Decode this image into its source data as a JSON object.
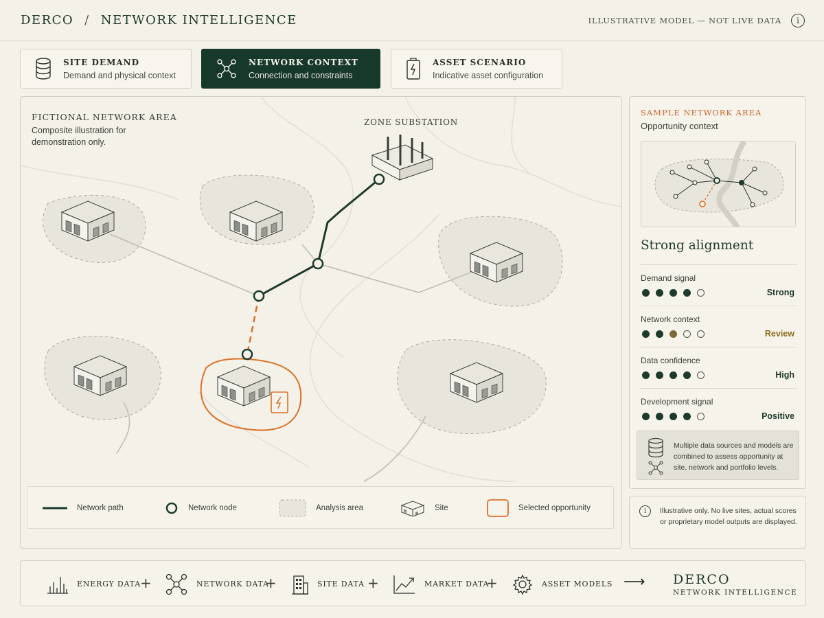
{
  "header": {
    "brand": "DERCO",
    "separator": "/",
    "section": "NETWORK INTELLIGENCE",
    "disclaimer": "ILLUSTRATIVE MODEL — NOT LIVE DATA",
    "info_icon": "info-icon"
  },
  "tabs": [
    {
      "title": "SITE DEMAND",
      "subtitle": "Demand and physical context",
      "icon": "database-icon",
      "active": false
    },
    {
      "title": "NETWORK CONTEXT",
      "subtitle": "Connection and constraints",
      "icon": "network-icon",
      "active": true
    },
    {
      "title": "ASSET SCENARIO",
      "subtitle": "Indicative asset configuration",
      "icon": "battery-icon",
      "active": false
    }
  ],
  "map": {
    "area_title": "FICTIONAL NETWORK AREA",
    "area_subtitle": "Composite illustration for demonstration only.",
    "substation_label": "ZONE SUBSTATION",
    "legend": {
      "network_path": "Network path",
      "network_node": "Network node",
      "analysis_area": "Analysis area",
      "site": "Site",
      "selected_opportunity": "Selected opportunity"
    }
  },
  "side": {
    "title": "SAMPLE NETWORK AREA",
    "subtitle": "Opportunity context",
    "alignment": "Strong alignment",
    "metrics": [
      {
        "label": "Demand signal",
        "value": "Strong",
        "filled": 4,
        "total": 5,
        "status": "strong"
      },
      {
        "label": "Network context",
        "value": "Review",
        "filled": 3,
        "total": 5,
        "status": "review"
      },
      {
        "label": "Data confidence",
        "value": "High",
        "filled": 4,
        "total": 5,
        "status": "strong"
      },
      {
        "label": "Development signal",
        "value": "Positive",
        "filled": 4,
        "total": 5,
        "status": "strong"
      }
    ],
    "data_note": "Multiple data sources and models are combined to assess opportunity at site, network and portfolio levels.",
    "illustrative_note": "Illustrative only. No live sites, actual scores or proprietary model outputs are displayed."
  },
  "bottom": {
    "items": [
      {
        "label": "ENERGY DATA",
        "icon": "bar-chart-icon"
      },
      {
        "label": "NETWORK DATA",
        "icon": "network-icon"
      },
      {
        "label": "SITE DATA",
        "icon": "building-icon"
      },
      {
        "label": "MARKET DATA",
        "icon": "trend-icon"
      },
      {
        "label": "ASSET MODELS",
        "icon": "gear-icon"
      }
    ],
    "plus": "+",
    "arrow": "⟶",
    "brand": "DERCO",
    "brand_sub": "NETWORK INTELLIGENCE"
  },
  "colors": {
    "primary": "#17392c",
    "accent": "#d9722a",
    "background": "#f4f1e8",
    "review": "#8a6d1f"
  }
}
